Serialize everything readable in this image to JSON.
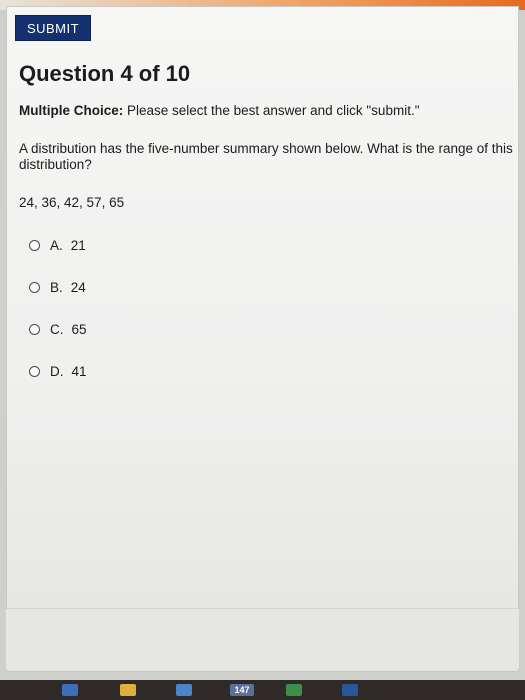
{
  "toolbar": {
    "submit_label": "SUBMIT"
  },
  "question": {
    "title": "Question 4 of 10",
    "type_label": "Multiple Choice:",
    "instructions": "Please select the best answer and click \"submit.\"",
    "prompt": "A distribution has the five-number summary shown below. What is the range of this distribution?",
    "data_values": "24, 36, 42, 57, 65"
  },
  "options": [
    {
      "letter": "A.",
      "value": "21"
    },
    {
      "letter": "B.",
      "value": "24"
    },
    {
      "letter": "C.",
      "value": "65"
    },
    {
      "letter": "D.",
      "value": "41"
    }
  ],
  "taskbar": {
    "badge_text": "147",
    "icons": [
      "edge-icon",
      "file-explorer-icon",
      "store-icon",
      "chrome-icon",
      "word-icon",
      "app-icon"
    ]
  },
  "colors": {
    "submit_bg": "#14306e",
    "page_bg": "#f3f3f2",
    "text": "#1c1c1c"
  }
}
